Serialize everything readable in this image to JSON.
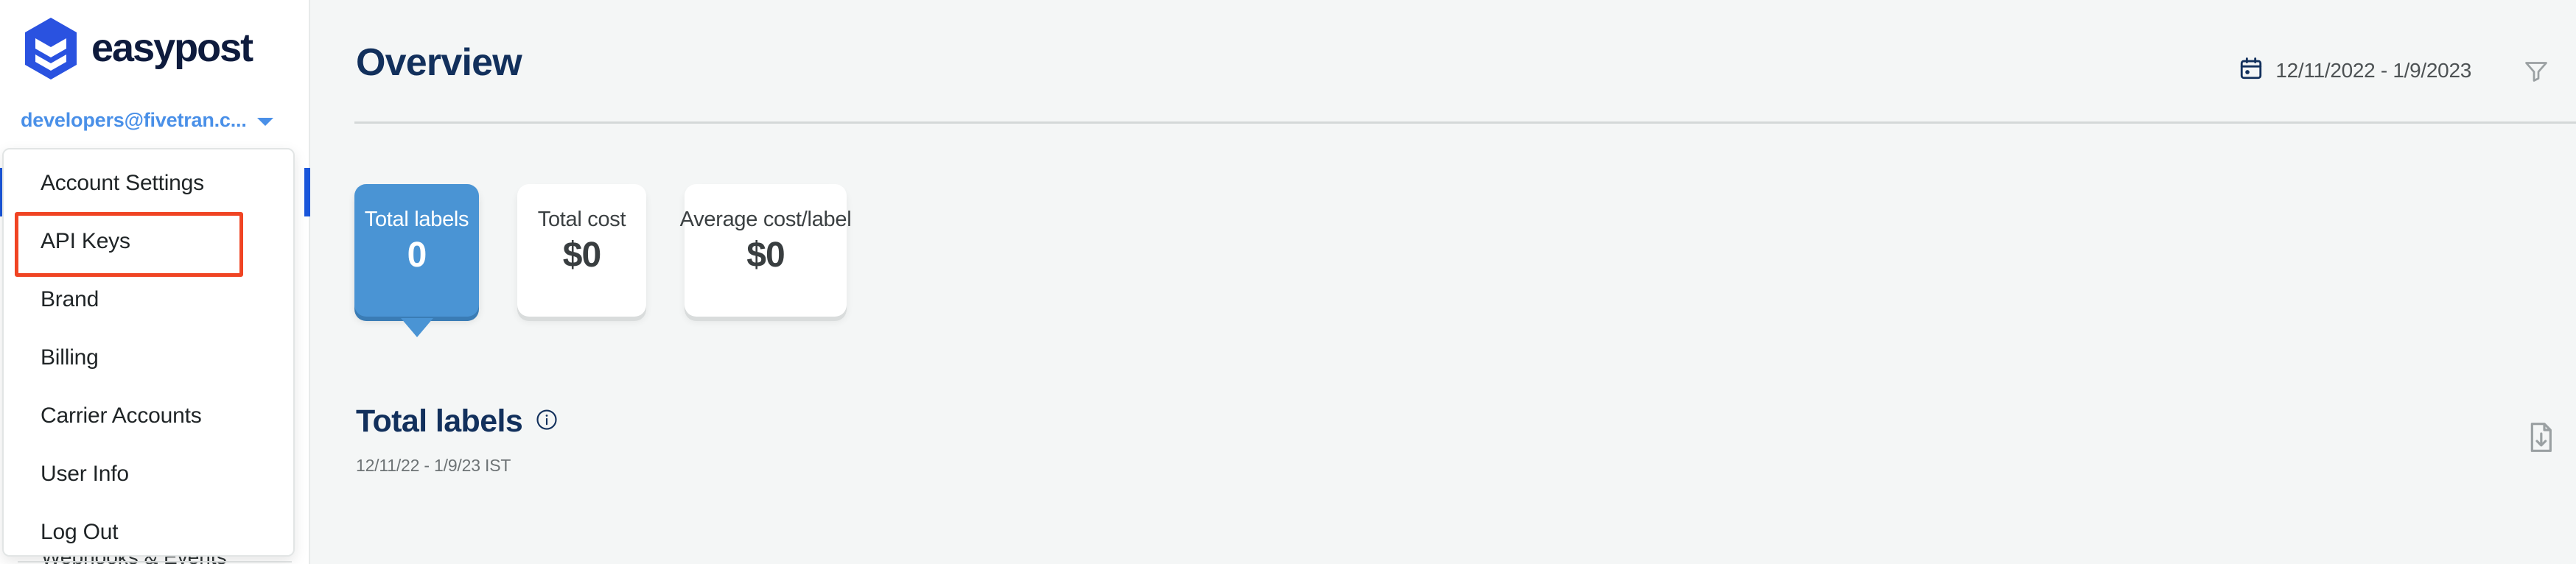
{
  "brand": {
    "name": "easypost",
    "logo_icon": "easypost-hexagon-logo",
    "mark_color": "#2a52e0",
    "wordmark_color": "#0e1b3d"
  },
  "sidebar": {
    "account_email": "developers@fivetran.c...",
    "caret_icon": "chevron-down-icon",
    "hidden_nav_item": "Webhooks & Events"
  },
  "account_menu": {
    "items": [
      {
        "label": "Account Settings",
        "highlighted": false
      },
      {
        "label": "API Keys",
        "highlighted": true
      },
      {
        "label": "Brand",
        "highlighted": false
      },
      {
        "label": "Billing",
        "highlighted": false
      },
      {
        "label": "Carrier Accounts",
        "highlighted": false
      },
      {
        "label": "User Info",
        "highlighted": false
      },
      {
        "label": "Log Out",
        "highlighted": false
      }
    ],
    "highlight_color": "#f04423"
  },
  "header": {
    "title": "Overview",
    "date_range": "12/11/2022 - 1/9/2023",
    "calendar_icon": "calendar-icon",
    "filter_icon": "filter-funnel-icon"
  },
  "stat_cards": [
    {
      "label": "Total labels",
      "value": "0",
      "active": true
    },
    {
      "label": "Total cost",
      "value": "$0",
      "active": false
    },
    {
      "label": "Average cost/label",
      "value": "$0",
      "active": false
    }
  ],
  "section": {
    "title": "Total labels",
    "info_icon": "info-circle-icon",
    "subtitle": "12/11/22 - 1/9/23 IST",
    "export_icon": "document-download-icon"
  },
  "colors": {
    "accent_blue": "#4a94d4",
    "brand_navy": "#12305c",
    "link_blue": "#4a90e8",
    "page_bg": "#f4f6f6"
  }
}
